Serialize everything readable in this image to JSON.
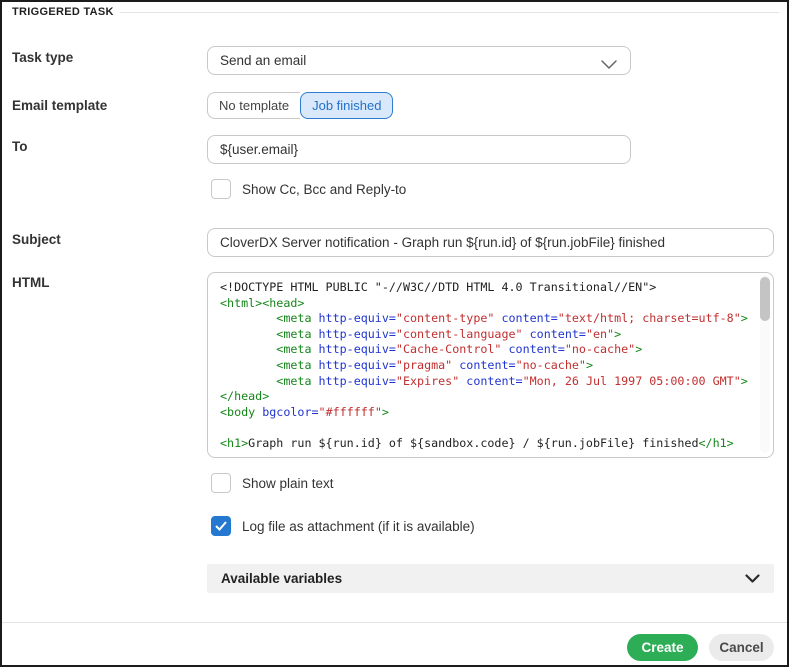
{
  "panel": {
    "title": "TRIGGERED TASK"
  },
  "form": {
    "task_type": {
      "label": "Task type",
      "value": "Send an email"
    },
    "email_template": {
      "label": "Email template",
      "options": [
        {
          "label": "No template",
          "selected": false
        },
        {
          "label": "Job finished",
          "selected": true
        }
      ]
    },
    "to": {
      "label": "To",
      "value": "${user.email}"
    },
    "show_cc": {
      "label": "Show Cc, Bcc and Reply-to",
      "checked": false
    },
    "subject": {
      "label": "Subject",
      "value": "CloverDX Server notification - Graph run ${run.id} of ${run.jobFile} finished"
    },
    "html": {
      "label": "HTML",
      "lines": [
        [
          {
            "c": "plain",
            "s": "<!DOCTYPE HTML PUBLIC \"-//W3C//DTD HTML 4.0 Transitional//EN\">"
          }
        ],
        [
          {
            "c": "tag",
            "s": "<html><head>"
          }
        ],
        [
          {
            "c": "tag",
            "s": "        <meta "
          },
          {
            "c": "attr",
            "s": "http-equiv="
          },
          {
            "c": "val",
            "s": "\"content-type\""
          },
          {
            "c": "attr",
            "s": " content="
          },
          {
            "c": "val",
            "s": "\"text/html; charset=utf-8\""
          },
          {
            "c": "tag",
            "s": ">"
          }
        ],
        [
          {
            "c": "tag",
            "s": "        <meta "
          },
          {
            "c": "attr",
            "s": "http-equiv="
          },
          {
            "c": "val",
            "s": "\"content-language\""
          },
          {
            "c": "attr",
            "s": " content="
          },
          {
            "c": "val",
            "s": "\"en\""
          },
          {
            "c": "tag",
            "s": ">"
          }
        ],
        [
          {
            "c": "tag",
            "s": "        <meta "
          },
          {
            "c": "attr",
            "s": "http-equiv="
          },
          {
            "c": "val",
            "s": "\"Cache-Control\""
          },
          {
            "c": "attr",
            "s": " content="
          },
          {
            "c": "val",
            "s": "\"no-cache\""
          },
          {
            "c": "tag",
            "s": ">"
          }
        ],
        [
          {
            "c": "tag",
            "s": "        <meta "
          },
          {
            "c": "attr",
            "s": "http-equiv="
          },
          {
            "c": "val",
            "s": "\"pragma\""
          },
          {
            "c": "attr",
            "s": " content="
          },
          {
            "c": "val",
            "s": "\"no-cache\""
          },
          {
            "c": "tag",
            "s": ">"
          }
        ],
        [
          {
            "c": "tag",
            "s": "        <meta "
          },
          {
            "c": "attr",
            "s": "http-equiv="
          },
          {
            "c": "val",
            "s": "\"Expires\""
          },
          {
            "c": "attr",
            "s": " content="
          },
          {
            "c": "val",
            "s": "\"Mon, 26 Jul 1997 05:00:00 GMT\""
          },
          {
            "c": "tag",
            "s": ">"
          }
        ],
        [
          {
            "c": "tag",
            "s": "</head>"
          }
        ],
        [
          {
            "c": "tag",
            "s": "<body "
          },
          {
            "c": "attr",
            "s": "bgcolor="
          },
          {
            "c": "val",
            "s": "\"#ffffff\""
          },
          {
            "c": "tag",
            "s": ">"
          }
        ],
        [],
        [
          {
            "c": "tag",
            "s": "<h1>"
          },
          {
            "c": "plain",
            "s": "Graph run ${run.id} of ${sandbox.code} / ${run.jobFile} finished"
          },
          {
            "c": "tag",
            "s": "</h1>"
          }
        ]
      ]
    },
    "show_plain_text": {
      "label": "Show plain text",
      "checked": false
    },
    "log_attachment": {
      "label": "Log file as attachment (if it is available)",
      "checked": true
    },
    "available_variables": {
      "label": "Available variables"
    }
  },
  "footer": {
    "create_label": "Create",
    "cancel_label": "Cancel"
  },
  "colors": {
    "accent_blue": "#2478d0",
    "selected_segment_bg": "#d9e8fa",
    "selected_segment_border": "#2d7dd2",
    "create_green": "#2dad56",
    "code_tag_green": "#15861a",
    "code_attr_blue": "#2135ce",
    "code_value_red": "#c22f2f"
  }
}
